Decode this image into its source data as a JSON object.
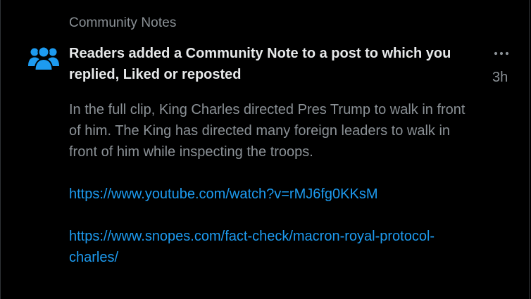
{
  "section": {
    "label": "Community Notes"
  },
  "notification": {
    "icon": "people-icon",
    "title": "Readers added a Community Note to a post to which you replied, Liked or reposted",
    "timestamp": "3h",
    "more_icon": "more-horizontal-icon"
  },
  "note": {
    "text": "In the full clip, King Charles directed Pres Trump to walk in front of him. The King has directed many foreign leaders to walk in front of him while inspecting the troops.",
    "links": [
      "https://www.youtube.com/watch?v=rMJ6fg0KKsM",
      "https://www.snopes.com/fact-check/macron-royal-protocol-charles/"
    ]
  },
  "colors": {
    "background": "#000000",
    "title_text": "#e7e9ea",
    "secondary_text": "#8b9196",
    "link": "#1d9bf0",
    "icon_blue": "#1d9bf0"
  }
}
